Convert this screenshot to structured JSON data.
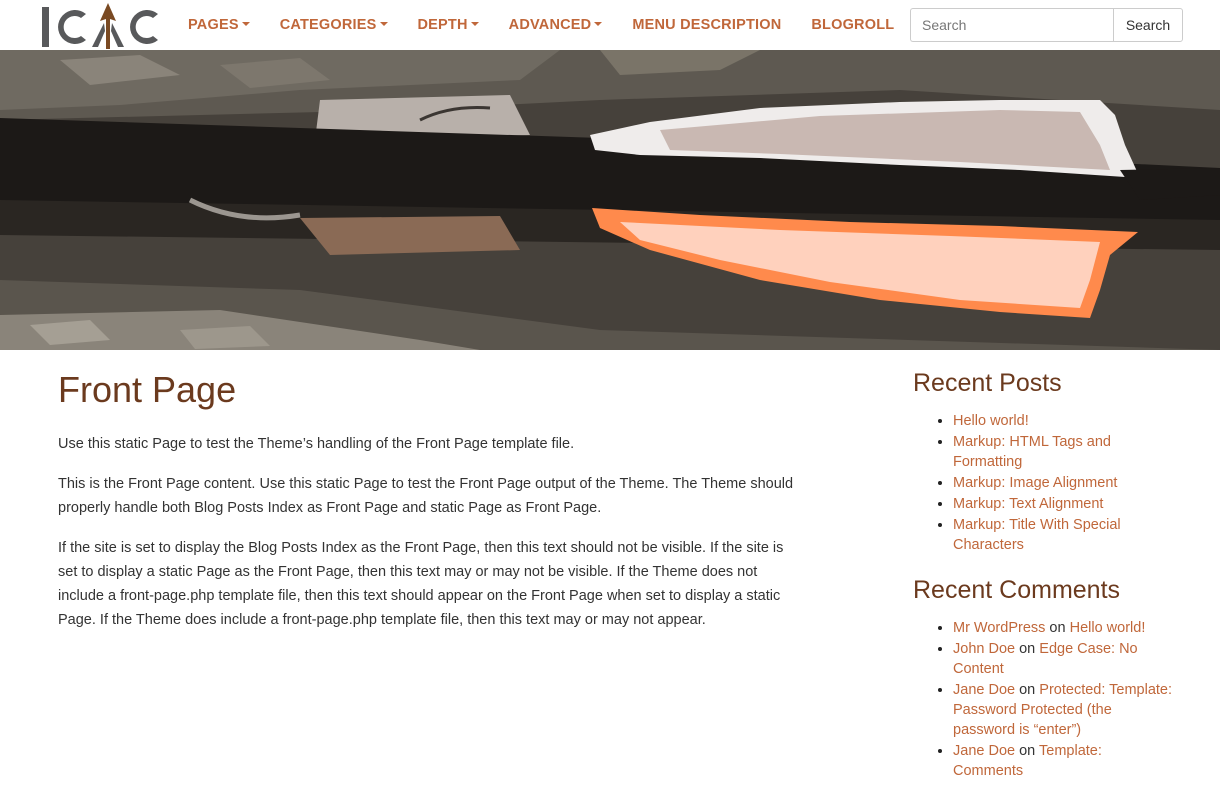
{
  "brand": {
    "logo_text": "ICAC"
  },
  "nav": {
    "items": [
      {
        "label": "PAGES",
        "dropdown": true
      },
      {
        "label": "CATEGORIES",
        "dropdown": true
      },
      {
        "label": "DEPTH",
        "dropdown": true
      },
      {
        "label": "ADVANCED",
        "dropdown": true
      },
      {
        "label": "MENU DESCRIPTION",
        "dropdown": false
      },
      {
        "label": "BLOGROLL",
        "dropdown": false
      }
    ]
  },
  "search": {
    "placeholder": "Search",
    "button_label": "Search"
  },
  "page": {
    "title": "Front Page",
    "paragraphs": [
      "Use this static Page to test the Theme’s handling of the Front Page template file.",
      "This is the Front Page content. Use this static Page to test the Front Page output of the Theme. The Theme should properly handle both Blog Posts Index as Front Page and static Page as Front Page.",
      "If the site is set to display the Blog Posts Index as the Front Page, then this text should not be visible. If the site is set to display a static Page as the Front Page, then this text may or may not be visible. If the Theme does not include a front-page.php template file, then this text should appear on the Front Page when set to display a static Page. If the Theme does include a front-page.php template file, then this text may or may not appear."
    ]
  },
  "sidebar": {
    "recent_posts": {
      "title": "Recent Posts",
      "items": [
        "Hello world!",
        "Markup: HTML Tags and Formatting",
        "Markup: Image Alignment",
        "Markup: Text Alignment",
        "Markup: Title With Special Characters"
      ]
    },
    "recent_comments": {
      "title": "Recent Comments",
      "connector": "on",
      "items": [
        {
          "author": "Mr WordPress",
          "post": "Hello world!"
        },
        {
          "author": "John Doe",
          "post": "Edge Case: No Content"
        },
        {
          "author": "Jane Doe",
          "post": "Protected: Template: Password Protected (the password is “enter”)"
        },
        {
          "author": "Jane Doe",
          "post": "Template: Comments"
        }
      ]
    }
  },
  "colors": {
    "accent": "#c0673a",
    "heading": "#6b3a1e",
    "logo_gray": "#58595b",
    "logo_arrow": "#7a4a23"
  }
}
